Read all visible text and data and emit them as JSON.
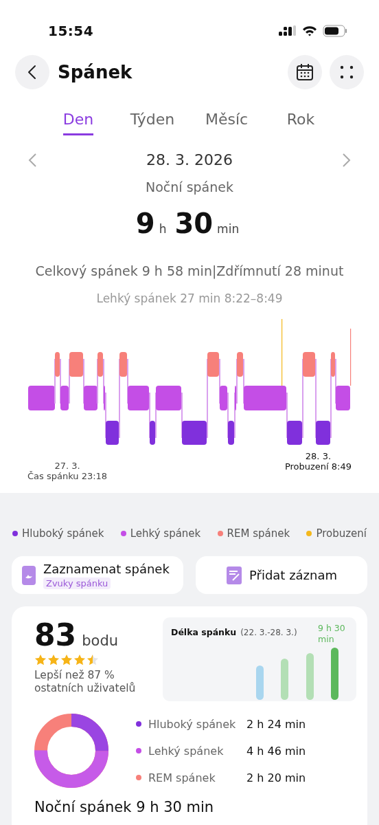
{
  "status_bar": {
    "time": "15:54"
  },
  "header": {
    "title": "Spánek"
  },
  "tabs": [
    {
      "label": "Den",
      "selected": true
    },
    {
      "label": "Týden",
      "selected": false
    },
    {
      "label": "Měsíc",
      "selected": false
    },
    {
      "label": "Rok",
      "selected": false
    }
  ],
  "date_nav": {
    "date": "28. 3. 2026"
  },
  "sleep": {
    "label": "Noční spánek",
    "hours": "9",
    "hours_unit": "h",
    "minutes": "30",
    "minutes_unit": "min"
  },
  "summary": "Celkový spánek 9 h 58 min|Zdřímnutí 28 minut",
  "detail": "Lehký spánek 27 min 8:22–8:49",
  "chart_labels": {
    "start_date": "27. 3.",
    "start_label": "Čas spánku 23:18",
    "end_date": "28. 3.",
    "end_label": "Probuzení 8:49"
  },
  "legend": [
    {
      "label": "Hluboký spánek",
      "color": "#8030dc"
    },
    {
      "label": "Lehký spánek",
      "color": "#c44ee6"
    },
    {
      "label": "REM spánek",
      "color": "#f7807a"
    },
    {
      "label": "Probuzení",
      "color": "#f4b81c"
    }
  ],
  "actions": [
    {
      "kind": "record",
      "label": "Zaznamenat spánek",
      "tag": "Zvuky spánku"
    },
    {
      "kind": "add",
      "label": "Přidat záznam"
    }
  ],
  "score": {
    "value": "83",
    "unit": "bodu",
    "stars": 4.5,
    "comparison": "Lepší než 87 % ostatních uživatelů"
  },
  "duration_chart": {
    "title": "Délka spánku",
    "range": "(22. 3.-28. 3.)",
    "latest": "9 h 30 min"
  },
  "stages": [
    {
      "label": "Hluboký spánek",
      "value": "2 h 24 min",
      "color": "#8030dc"
    },
    {
      "label": "Lehký spánek",
      "value": "4 h 46 min",
      "color": "#c44ee6"
    },
    {
      "label": "REM spánek",
      "value": "2 h 20 min",
      "color": "#f7807a"
    }
  ],
  "next_heading": "Noční spánek 9 h 30 min"
}
